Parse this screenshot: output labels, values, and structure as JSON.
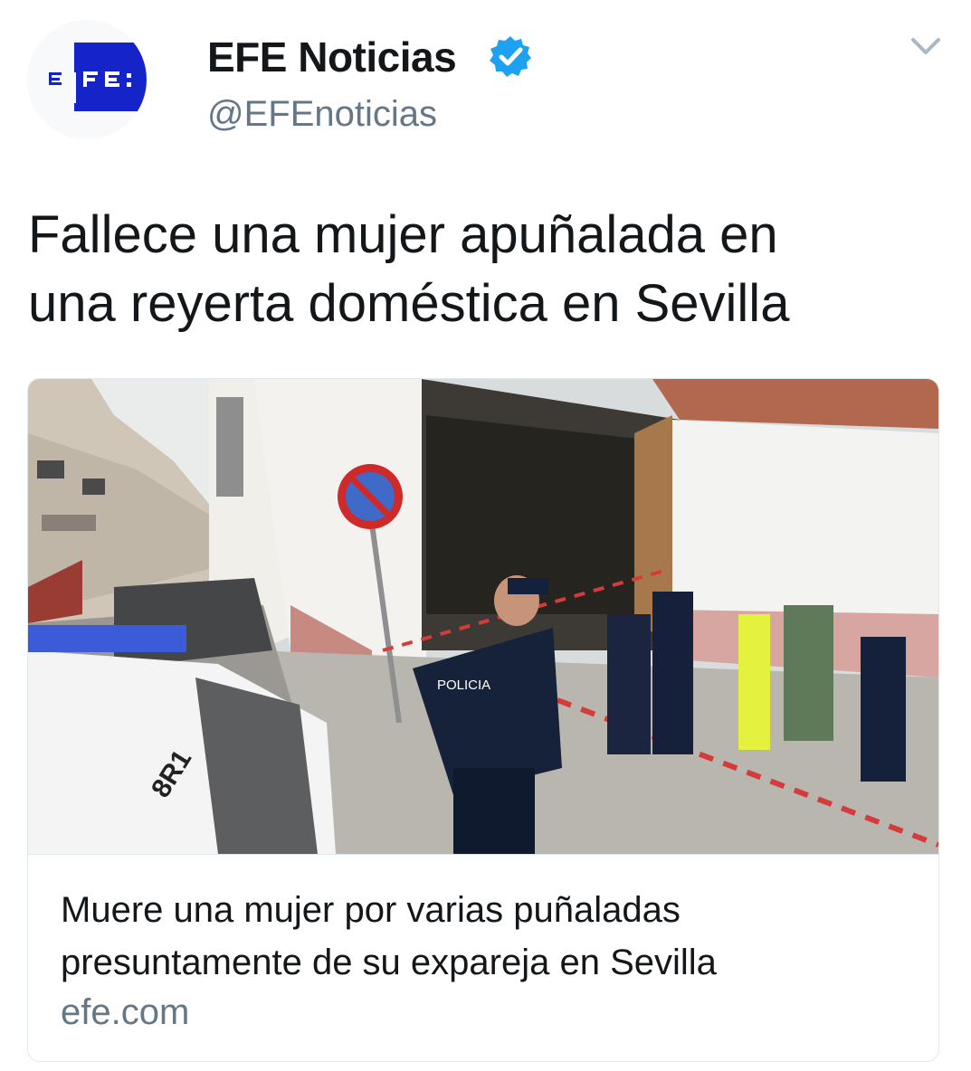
{
  "account": {
    "display_name": "EFE Noticias",
    "handle": "@EFEnoticias",
    "verified": true,
    "avatar_logo": "E F E :",
    "avatar_color": "#1424c8"
  },
  "tweet": {
    "text_lines": [
      "Fallece una mujer apuñalada en",
      "una reyerta doméstica en Sevilla"
    ]
  },
  "card": {
    "image_description_icon": "news-photo",
    "title_lines": [
      "Muere una mujer por varias puñaladas",
      "presuntamente de su expareja en Sevilla"
    ],
    "domain": "efe.com",
    "photo_text": {
      "police_label": "POLICIA",
      "car_plate": "8R1"
    }
  },
  "colors": {
    "verified_blue": "#1da1f2",
    "secondary_text": "#657786",
    "border": "#e1e8ed"
  },
  "icons": {
    "verified": "verified-badge-icon",
    "caret": "chevron-down-icon"
  }
}
